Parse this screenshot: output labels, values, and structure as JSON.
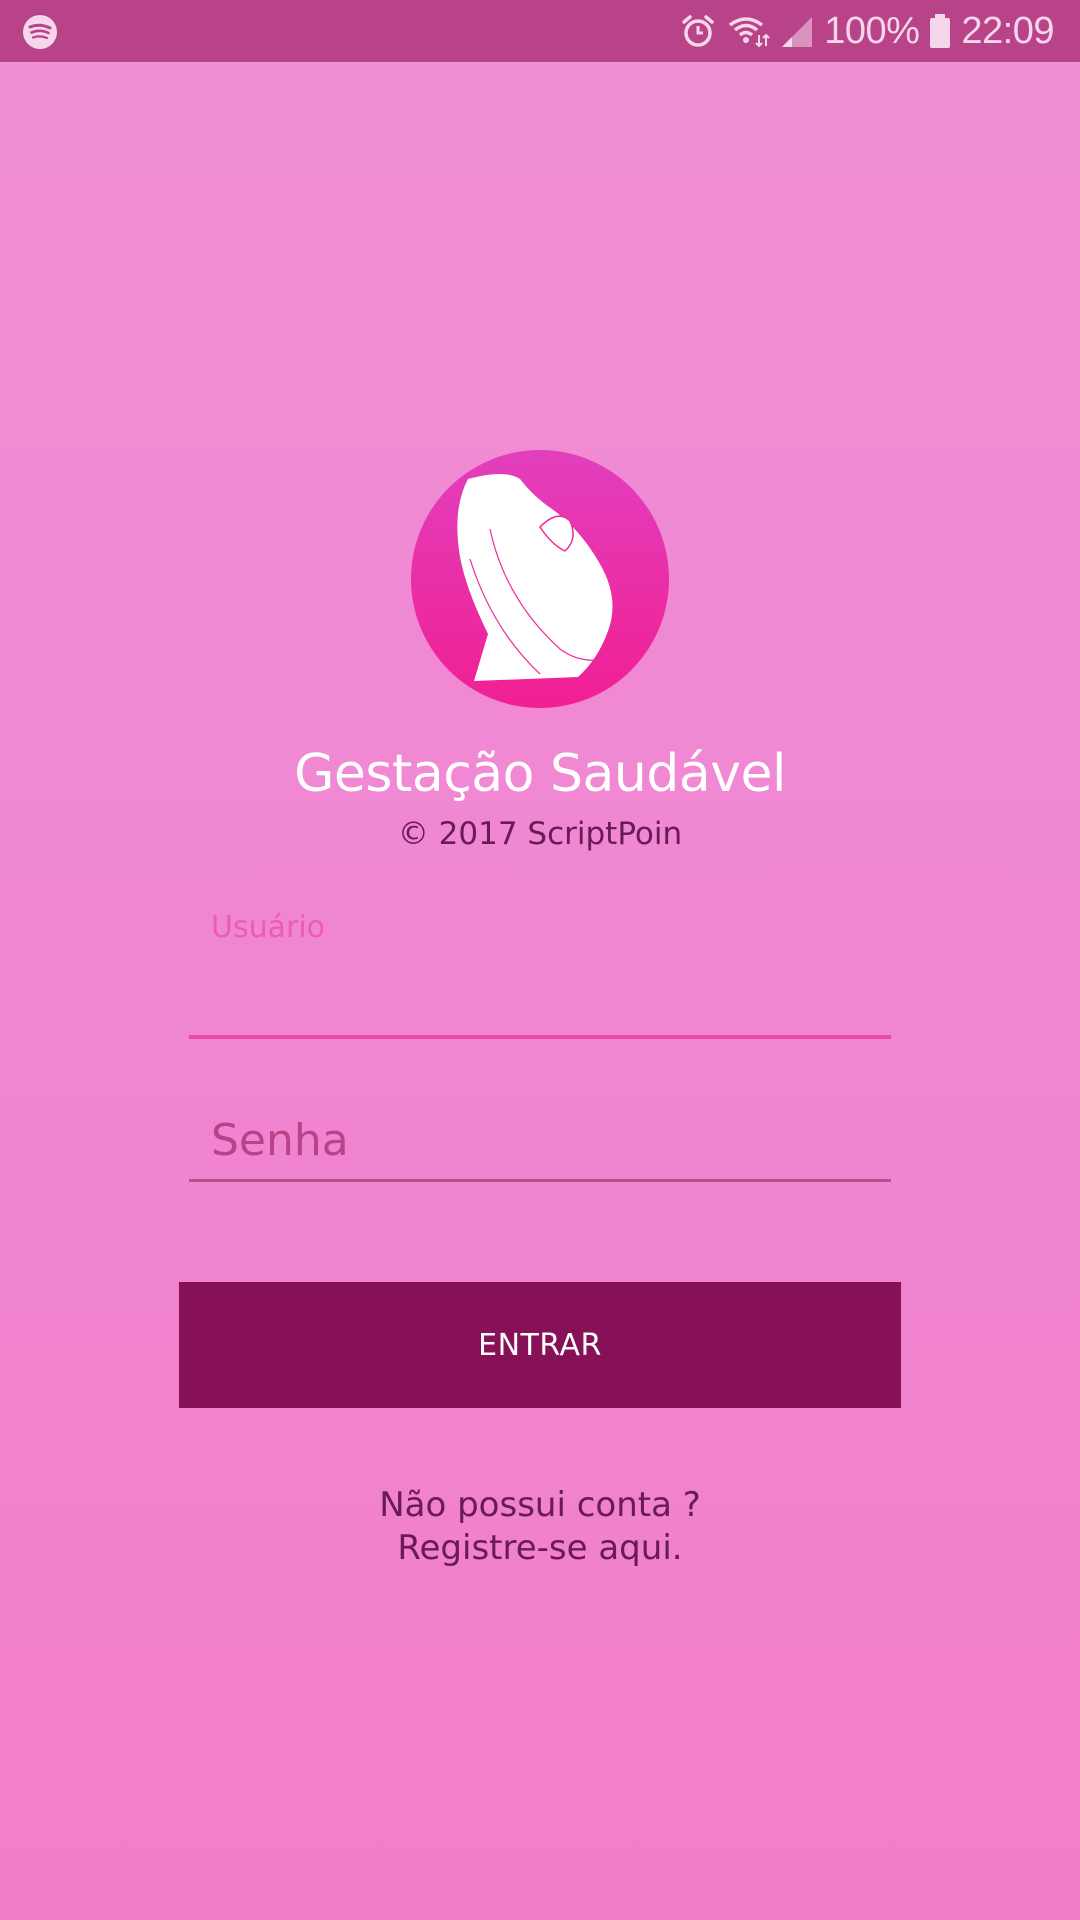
{
  "status_bar": {
    "left_icon": "spotify-icon",
    "icons": [
      "alarm-icon",
      "wifi-icon",
      "signal-icon",
      "battery-icon"
    ],
    "battery_percent": "100%",
    "time": "22:09",
    "background": "#b94389"
  },
  "app": {
    "logo_icon": "pregnant-woman-icon",
    "title": "Gestação Saudável",
    "copyright": "© 2017 ScriptPoin"
  },
  "form": {
    "username": {
      "label": "Usuário",
      "value": ""
    },
    "password": {
      "placeholder": "Senha",
      "value": ""
    },
    "submit_label": "ENTRAR"
  },
  "register": {
    "line1": "Não possui conta ?",
    "line2": "Registre-se aqui."
  },
  "colors": {
    "accent": "#e84aa6",
    "button": "#861157",
    "dark_text": "#6a1a55",
    "logo_circle": "#ec2c9c"
  }
}
